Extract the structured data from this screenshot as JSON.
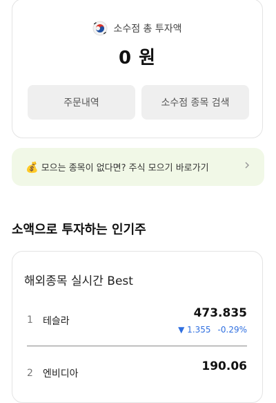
{
  "summary": {
    "title": "소수점 총 투자액",
    "amount": "0 원",
    "buttons": {
      "orders": "주문내역",
      "search": "소수점 종목 검색"
    }
  },
  "promo": {
    "text": "모으는 종목이 없다면? 주식 모으기 바로가기"
  },
  "section": {
    "title": "소액으로 투자하는 인기주"
  },
  "ranking": {
    "title": "해외종목 실시간 Best",
    "items": [
      {
        "rank": "1",
        "name": "테슬라",
        "price": "473.835",
        "change": "▼ 1.355",
        "change_pct": "-0.29%"
      },
      {
        "rank": "2",
        "name": "엔비디아",
        "price": "190.06"
      }
    ]
  },
  "colors": {
    "accent_blue": "#2f6fe0",
    "promo_bg": "#f1f8e7"
  }
}
